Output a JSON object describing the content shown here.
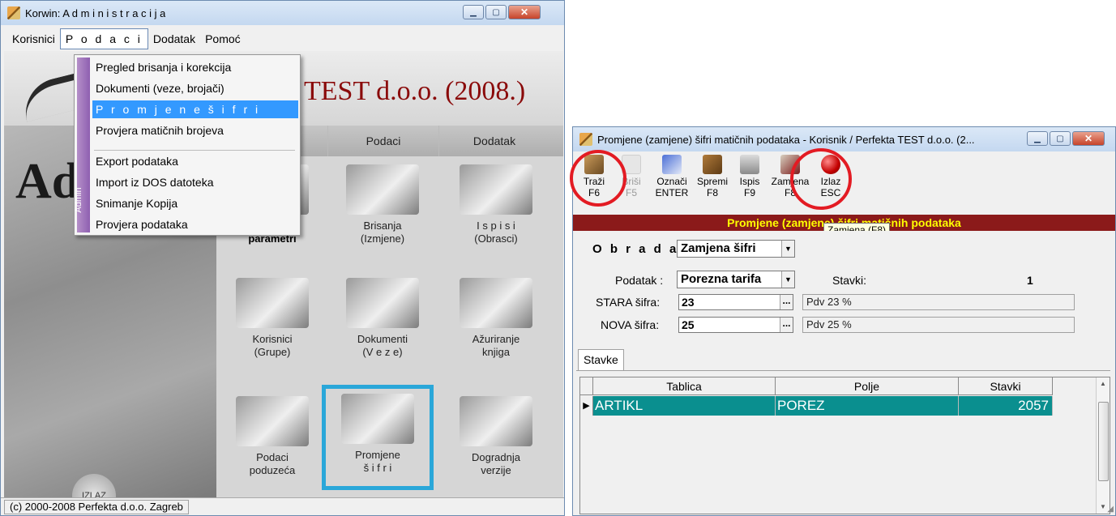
{
  "left_window": {
    "title": "Korwin: A d m i n i s t r a c i j a",
    "menu": [
      "Korisnici",
      "P o d a c i",
      "Dodatak",
      "Pomoć"
    ],
    "company_title": "TEST d.o.o. (2008.)",
    "big_letters": "Ad",
    "column_headers": [
      "Podaci",
      "Dodatak"
    ],
    "tiles": [
      {
        "label": "Programski\nparametri"
      },
      {
        "label": "Brisanja\n(Izmjene)"
      },
      {
        "label": "I s p i s i\n(Obrasci)"
      },
      {
        "label": "Korisnici\n(Grupe)"
      },
      {
        "label": "Dokumenti\n(V e z e)"
      },
      {
        "label": "Ažuriranje\nknjiga"
      },
      {
        "label": "Podaci\npoduzeća"
      },
      {
        "label": "Promjene\nš i f r i"
      },
      {
        "label": "Dogradnja\nverzije"
      }
    ],
    "izlaz": "IZLAZ",
    "status": "(c) 2000-2008 Perfekta d.o.o. Zagreb",
    "dropdown": {
      "side_label": "Admin",
      "items": [
        "Pregled brisanja i korekcija",
        "Dokumenti (veze, brojači)",
        "P r o m j e n e  š i f r i",
        "Provjera matičnih brojeva",
        "Export podataka",
        "Import iz DOS datoteka",
        "Snimanje Kopija",
        "Provjera podataka"
      ]
    }
  },
  "right_window": {
    "title": "Promjene (zamjene) šifri matičnih podataka - Korisnik / Perfekta TEST d.o.o. (2...",
    "toolbar": [
      {
        "label": "Traži",
        "key": "F6"
      },
      {
        "label": "Briši",
        "key": "F5"
      },
      {
        "label": "Označi",
        "key": "ENTER"
      },
      {
        "label": "Spremi",
        "key": "F8"
      },
      {
        "label": "Ispis",
        "key": "F9"
      },
      {
        "label": "Zamjena",
        "key": "F8"
      },
      {
        "label": "Izlaz",
        "key": "ESC"
      }
    ],
    "tooltip": "Zamjena (F8)",
    "header_strip": "Promjene (zamjene) šifri matičnih podataka",
    "obrada_label": "O b r a d a :",
    "obrada_value": "Zamjena šifri",
    "podatak_label": "Podatak :",
    "podatak_value": "Porezna tarifa",
    "stavki_label": "Stavki:",
    "stavki_value": "1",
    "stara_label": "STARA šifra:",
    "stara_value": "23",
    "stara_desc": "Pdv 23 %",
    "nova_label": "NOVA šifra:",
    "nova_value": "25",
    "nova_desc": "Pdv 25 %",
    "tab_label": "Stavke",
    "grid_headers": [
      "Tablica",
      "Polje",
      "Stavki"
    ],
    "grid_rows": [
      {
        "tablica": "ARTIKL",
        "polje": "POREZ",
        "stavki": "2057"
      }
    ]
  },
  "colors": {
    "highlight_border": "#2aa7d9",
    "annotation_ring": "#e31b23",
    "header_strip_bg": "#8b1a1a",
    "header_strip_fg": "#ffff00",
    "selected_row": "#0a8f8f",
    "menu_selected": "#3399ff"
  }
}
